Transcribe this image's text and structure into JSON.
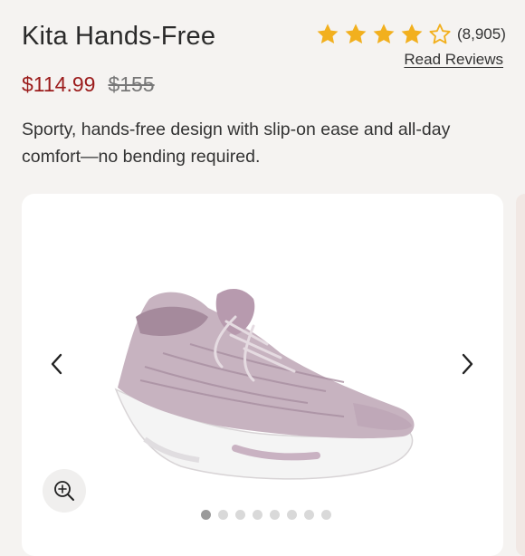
{
  "product": {
    "title": "Kita Hands-Free",
    "rating": 4.5,
    "review_count": "(8,905)",
    "read_reviews": "Read Reviews",
    "sale_price": "$114.99",
    "original_price": "$155",
    "description": "Sporty, hands-free design with slip-on ease and all-day comfort—no bending required."
  },
  "colors": {
    "star": "#f2b01e",
    "sale_price": "#9b1b1b",
    "shoe_upper": "#c7b3c0",
    "shoe_sole": "#f4f4f4"
  },
  "gallery": {
    "image_count": 8,
    "active_index": 0
  }
}
